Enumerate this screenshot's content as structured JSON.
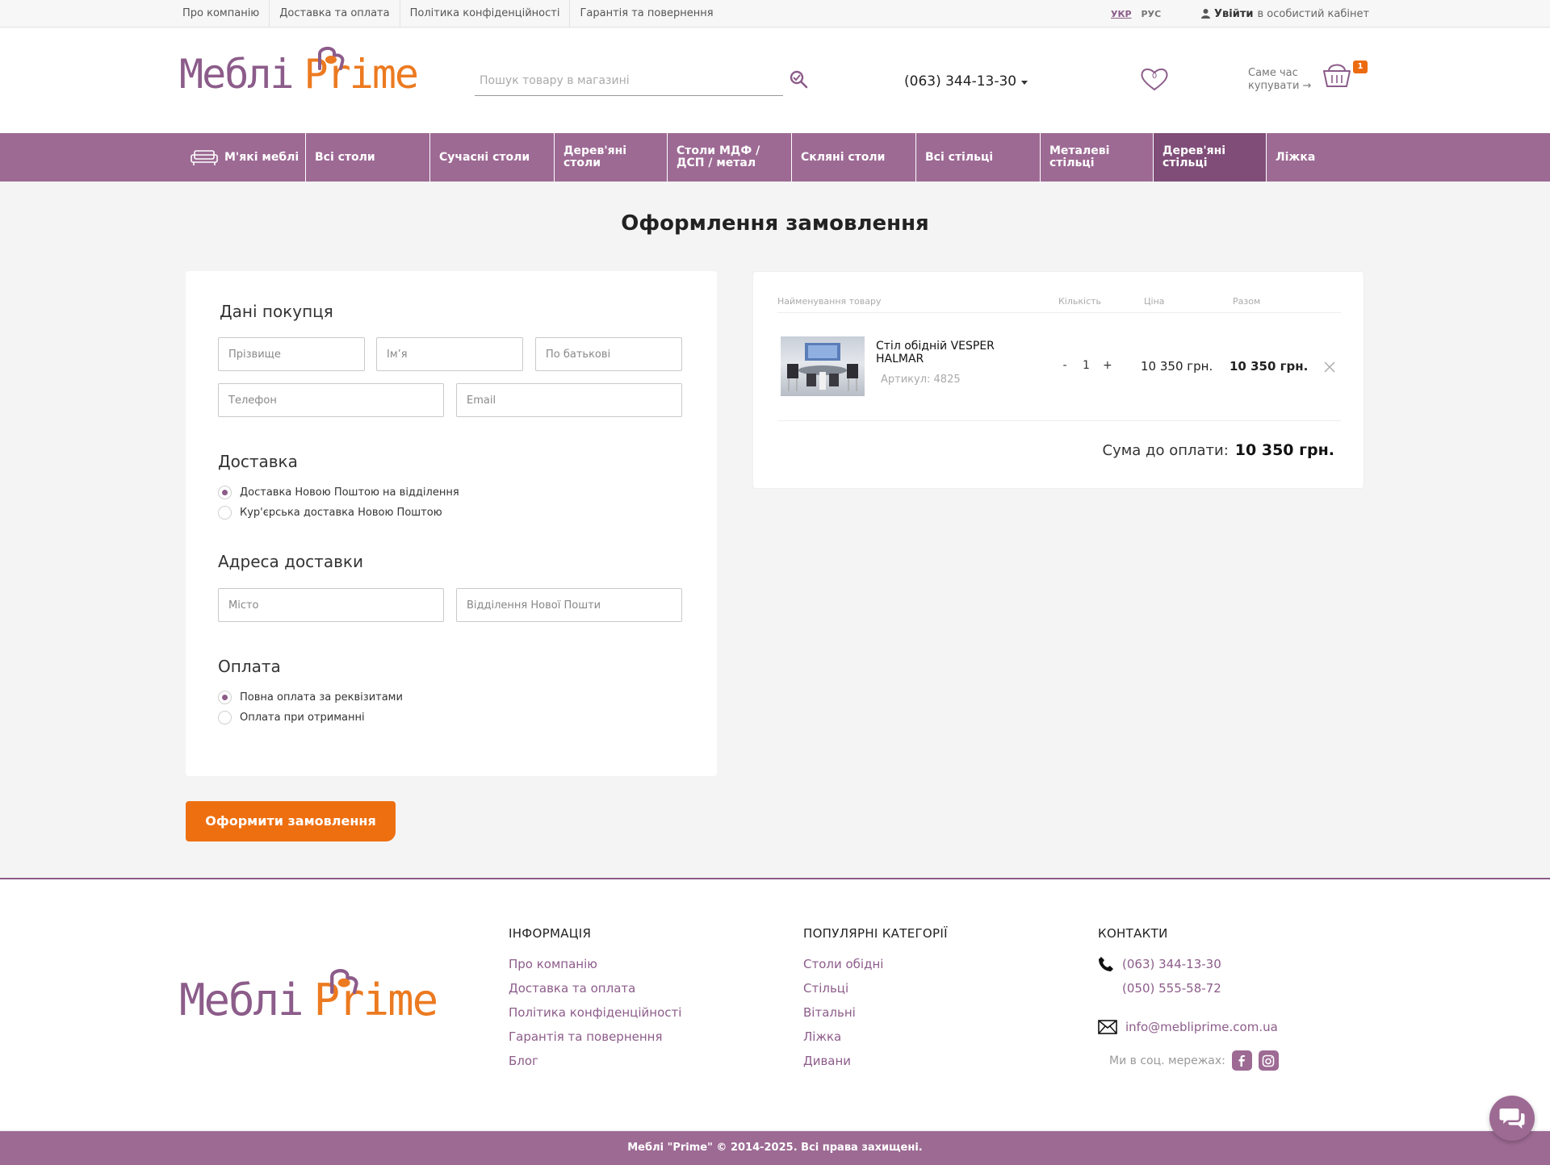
{
  "topbar": {
    "links": [
      "Про компанію",
      "Доставка та оплата",
      "Політика конфіденційності",
      "Гарантія та повернення"
    ],
    "lang_active": "УКР",
    "lang_inactive": "РУС",
    "login_bold": "Увійти",
    "login_rest": "в особистий кабінет"
  },
  "header": {
    "logo_word1": "Меблі",
    "logo_word2": "Prime",
    "search_placeholder": "Пошук товару в магазині",
    "phone": "(063) 344-13-30",
    "wishlist_count": "0",
    "buy_now_line1": "Саме час",
    "buy_now_line2": "купувати →",
    "cart_count": "1"
  },
  "nav": {
    "items": [
      "М'які меблі",
      "Всі столи",
      "Сучасні столи",
      "Дерев'яні столи",
      "Столи МДФ / ДСП / метал",
      "Скляні столи",
      "Всі стільці",
      "Металеві стільці",
      "Дерев'яні стільці",
      "Ліжка"
    ],
    "active_index": 8
  },
  "page": {
    "title": "Оформлення замовлення"
  },
  "form": {
    "buyer_heading": "Дані покупця",
    "lastname_placeholder": "Прізвище",
    "firstname_placeholder": "Ім’я",
    "patronymic_placeholder": "По батькові",
    "phone_placeholder": "Телефон",
    "email_placeholder": "Email",
    "delivery_heading": "Доставка",
    "delivery_option1": "Доставка Новою Поштою на відділення",
    "delivery_option2": "Кур'єрська доставка Новою Поштою",
    "address_heading": "Адреса доставки",
    "city_placeholder": "Місто",
    "branch_placeholder": "Відділення Нової Пошти",
    "payment_heading": "Оплата",
    "payment_option1": "Повна оплата за реквізитами",
    "payment_option2": "Оплата при отриманні",
    "submit_label": "Оформити замовлення"
  },
  "order": {
    "col_name": "Найменування товару",
    "col_qty": "Кількість",
    "col_price": "Ціна",
    "col_total": "Разом",
    "item_name": "Стіл обідній VESPER HALMAR",
    "item_sku": "Артикул: 4825",
    "item_qty": "1",
    "qty_minus": "-",
    "qty_plus": "+",
    "item_price": "10 350 грн.",
    "item_total": "10 350 грн.",
    "sum_label": "Сума до оплати:",
    "sum_value": "10 350 грн."
  },
  "footer": {
    "info_heading": "ІНФОРМАЦІЯ",
    "info_links": [
      "Про компанію",
      "Доставка та оплата",
      "Політика конфіденційності",
      "Гарантія та повернення",
      "Блог"
    ],
    "popular_heading": "ПОПУЛЯРНІ КАТЕГОРІЇ",
    "popular_links": [
      "Столи обідні",
      "Стільці",
      "Вітальні",
      "Ліжка",
      "Дивани"
    ],
    "contacts_heading": "КОНТАКТИ",
    "phone1": "(063) 344-13-30",
    "phone2": "(050) 555-58-72",
    "email": "info@mebliprime.com.ua",
    "social_label": "Ми в соц. мережах:",
    "copyright": "Меблі \"Prime\" © 2014-2025. Всі права захищені."
  },
  "colors": {
    "brand_purple": "#9d6a94",
    "brand_orange": "#ee6f10"
  }
}
